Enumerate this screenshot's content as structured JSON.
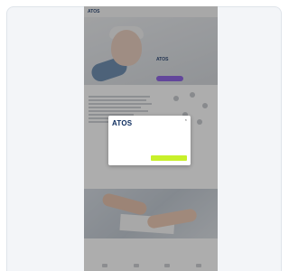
{
  "page": {
    "topbar": {
      "logo": "ATOS",
      "nav": [
        "",
        "",
        ""
      ]
    },
    "hero": {
      "title": "ATOS",
      "subtitle": ""
    },
    "section": {
      "heading": ""
    },
    "bottom": {
      "heading": ""
    }
  },
  "dialog": {
    "brand": "ATOS",
    "close_label": "×",
    "title": "",
    "text": "",
    "link": "",
    "reject_label": "",
    "accept_label": ""
  },
  "colors": {
    "brand": "#0a2a5c",
    "accept_button": "#c8f02a",
    "hero_cta": "#7e4fe0",
    "overlay": "#3c3c3c"
  },
  "icons": [
    "close-icon"
  ]
}
